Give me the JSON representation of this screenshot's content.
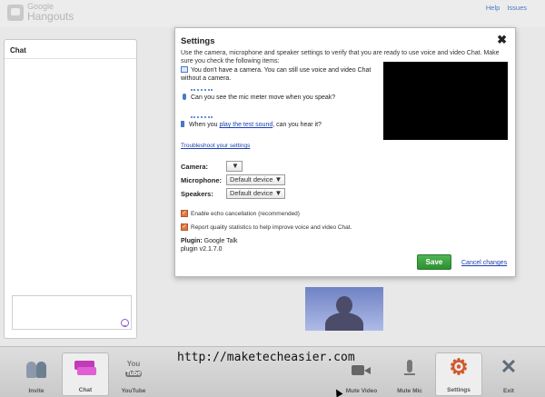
{
  "header": {
    "logo_line1": "Google",
    "logo_line2": "Hangouts",
    "links": [
      "Help",
      "Issues"
    ]
  },
  "chat": {
    "title": "Chat"
  },
  "settings": {
    "title": "Settings",
    "intro": "Use the camera, microphone and speaker settings to verify that you are ready to use voice and video Chat. Make sure you check the following items:",
    "camera_note": "You don't have a camera. You can still use voice and video Chat without a camera.",
    "mic_note": "Can you see the mic meter move when you speak?",
    "speaker_note_before": "When you ",
    "speaker_note_link": "play the test sound",
    "speaker_note_after": ", can you hear it?",
    "troubleshoot": "Troubleshoot your settings",
    "camera_label": "Camera:",
    "camera_value": "",
    "microphone_label": "Microphone:",
    "microphone_value": "Default device",
    "speakers_label": "Speakers:",
    "speakers_value": "Default device",
    "echo_label": "Enable echo cancellation (recommended)",
    "stats_label": "Report quality statistics to help improve voice and video Chat.",
    "plugin_label": "Plugin:",
    "plugin_name": "Google Talk",
    "plugin_version": "plugin v2.1.7.0",
    "save_label": "Save",
    "cancel_label": "Cancel changes"
  },
  "toolbar": {
    "invite": "Invite",
    "chat": "Chat",
    "youtube": "YouTube",
    "youtube_top": "You",
    "youtube_bottom": "Tube",
    "mute_video": "Mute Video",
    "mute_mic": "Mute Mic",
    "settings": "Settings",
    "exit": "Exit"
  },
  "watermark": "http://maketecheasier.com",
  "colors": {
    "save_green": "#2e8f33",
    "link_blue": "#1a3fb0",
    "gear_orange": "#d0582a"
  }
}
